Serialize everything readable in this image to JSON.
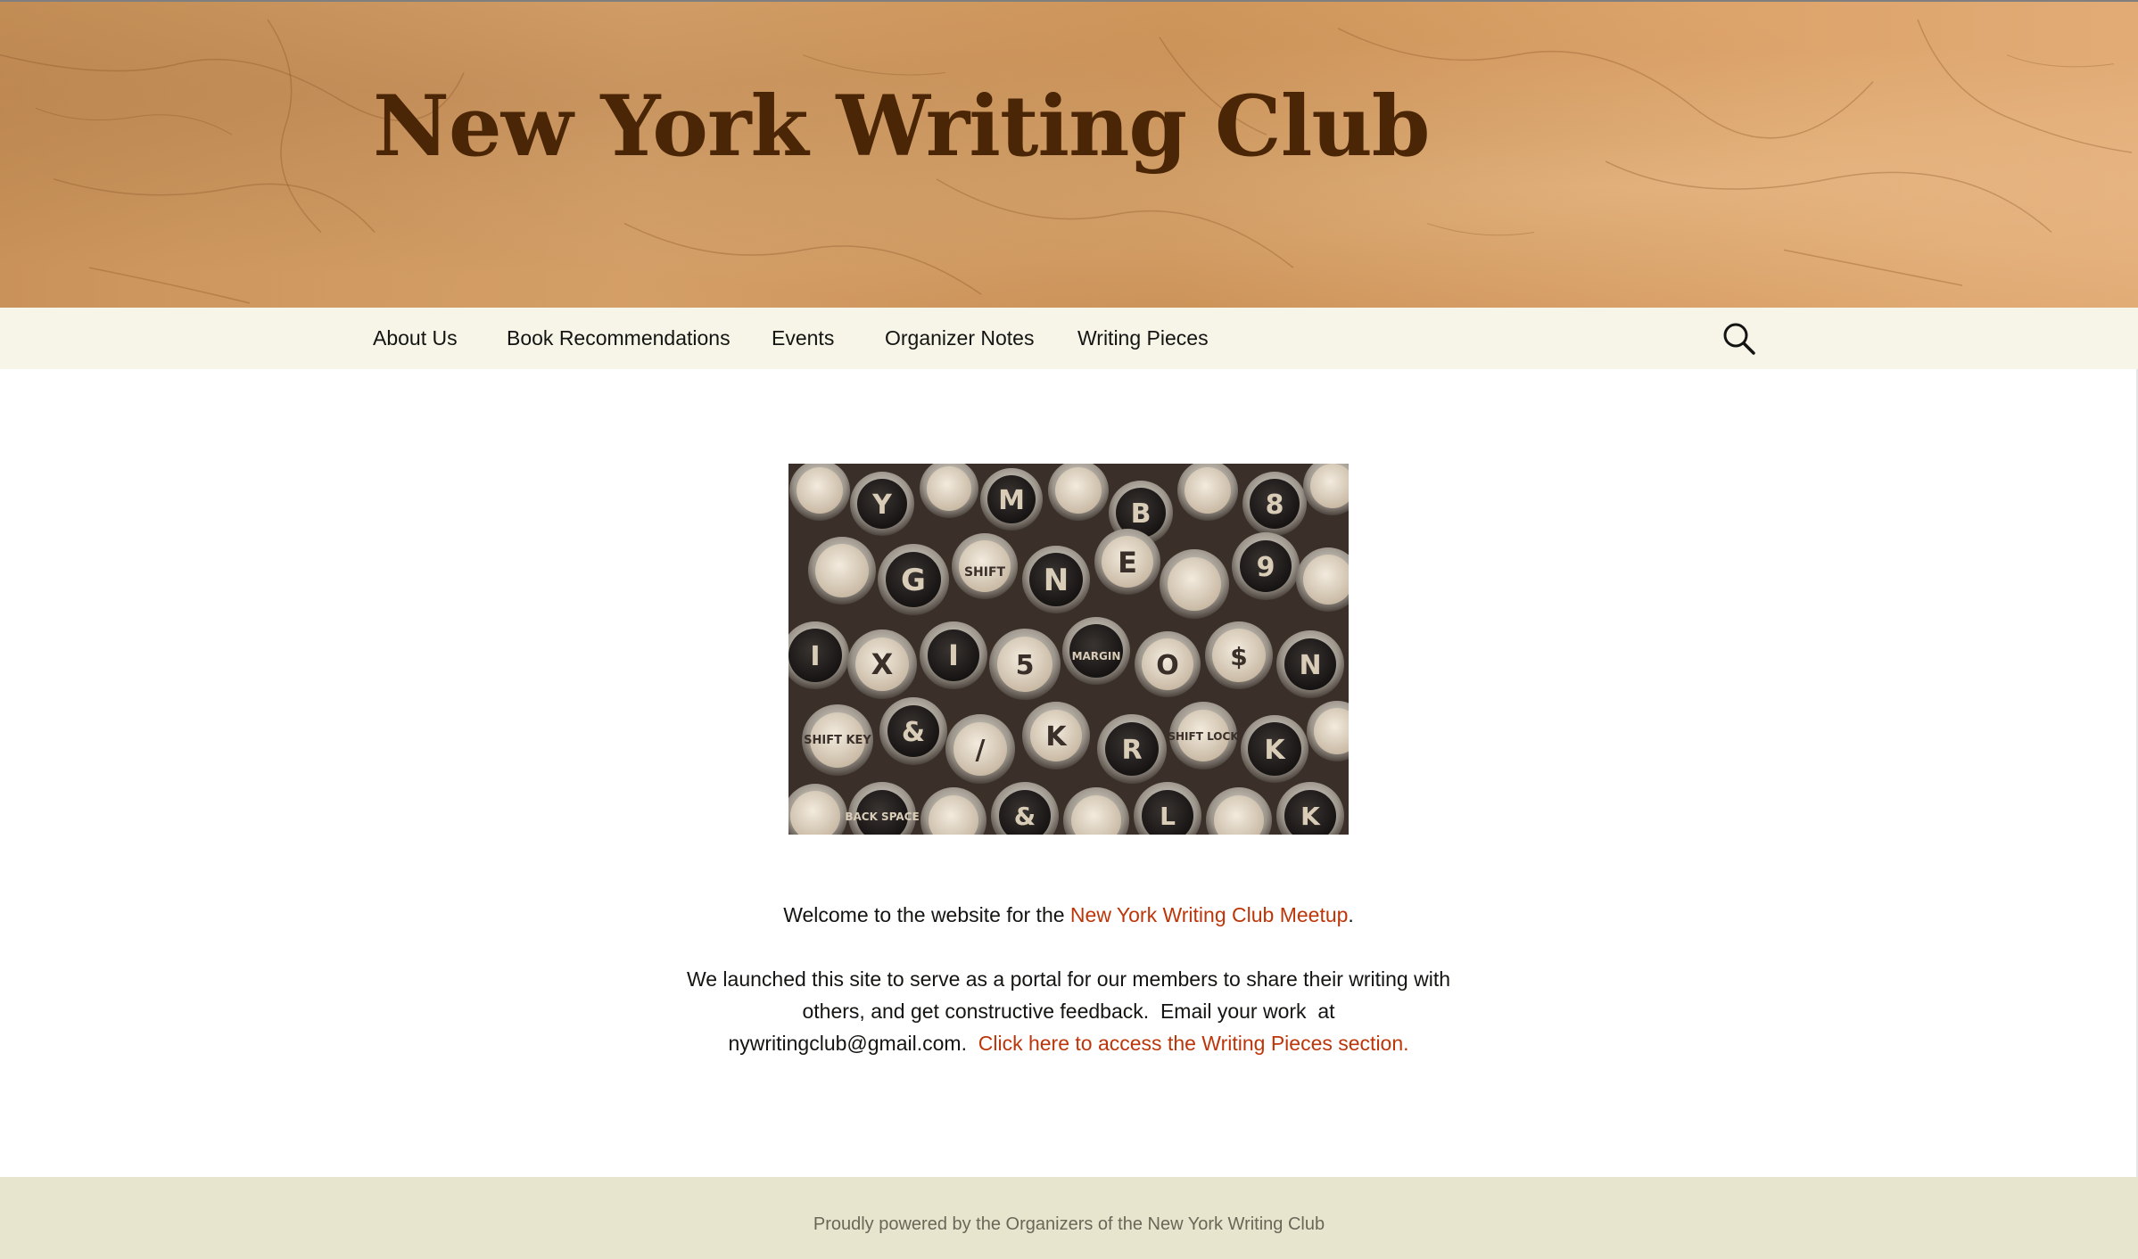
{
  "header": {
    "site_title": "New York Writing Club"
  },
  "nav": {
    "items": [
      {
        "label": "About Us"
      },
      {
        "label": "Book Recommendations"
      },
      {
        "label": "Events"
      },
      {
        "label": "Organizer Notes"
      },
      {
        "label": "Writing Pieces"
      }
    ],
    "search_icon": "search-icon"
  },
  "content": {
    "image_description_icon": "typewriter-keys-image",
    "welcome_text_before": "Welcome to the website for the ",
    "welcome_link": "New York Writing Club Meetup",
    "welcome_text_after": ".",
    "intro_line1": "We launched this site to serve as a portal for our members to share their writing with",
    "intro_line2": "others, and get constructive feedback.  Email your work  at",
    "intro_line3_text": "nywritingclub@gmail.com.  ",
    "intro_link": "Click here to access the Writing Pieces section."
  },
  "footer": {
    "text": "Proudly powered by the Organizers of the New York Writing Club"
  },
  "colors": {
    "title": "#4b2606",
    "link": "#bc360a",
    "navbar_bg": "#f7f5e7",
    "footer_bg": "#e8e5ce"
  }
}
